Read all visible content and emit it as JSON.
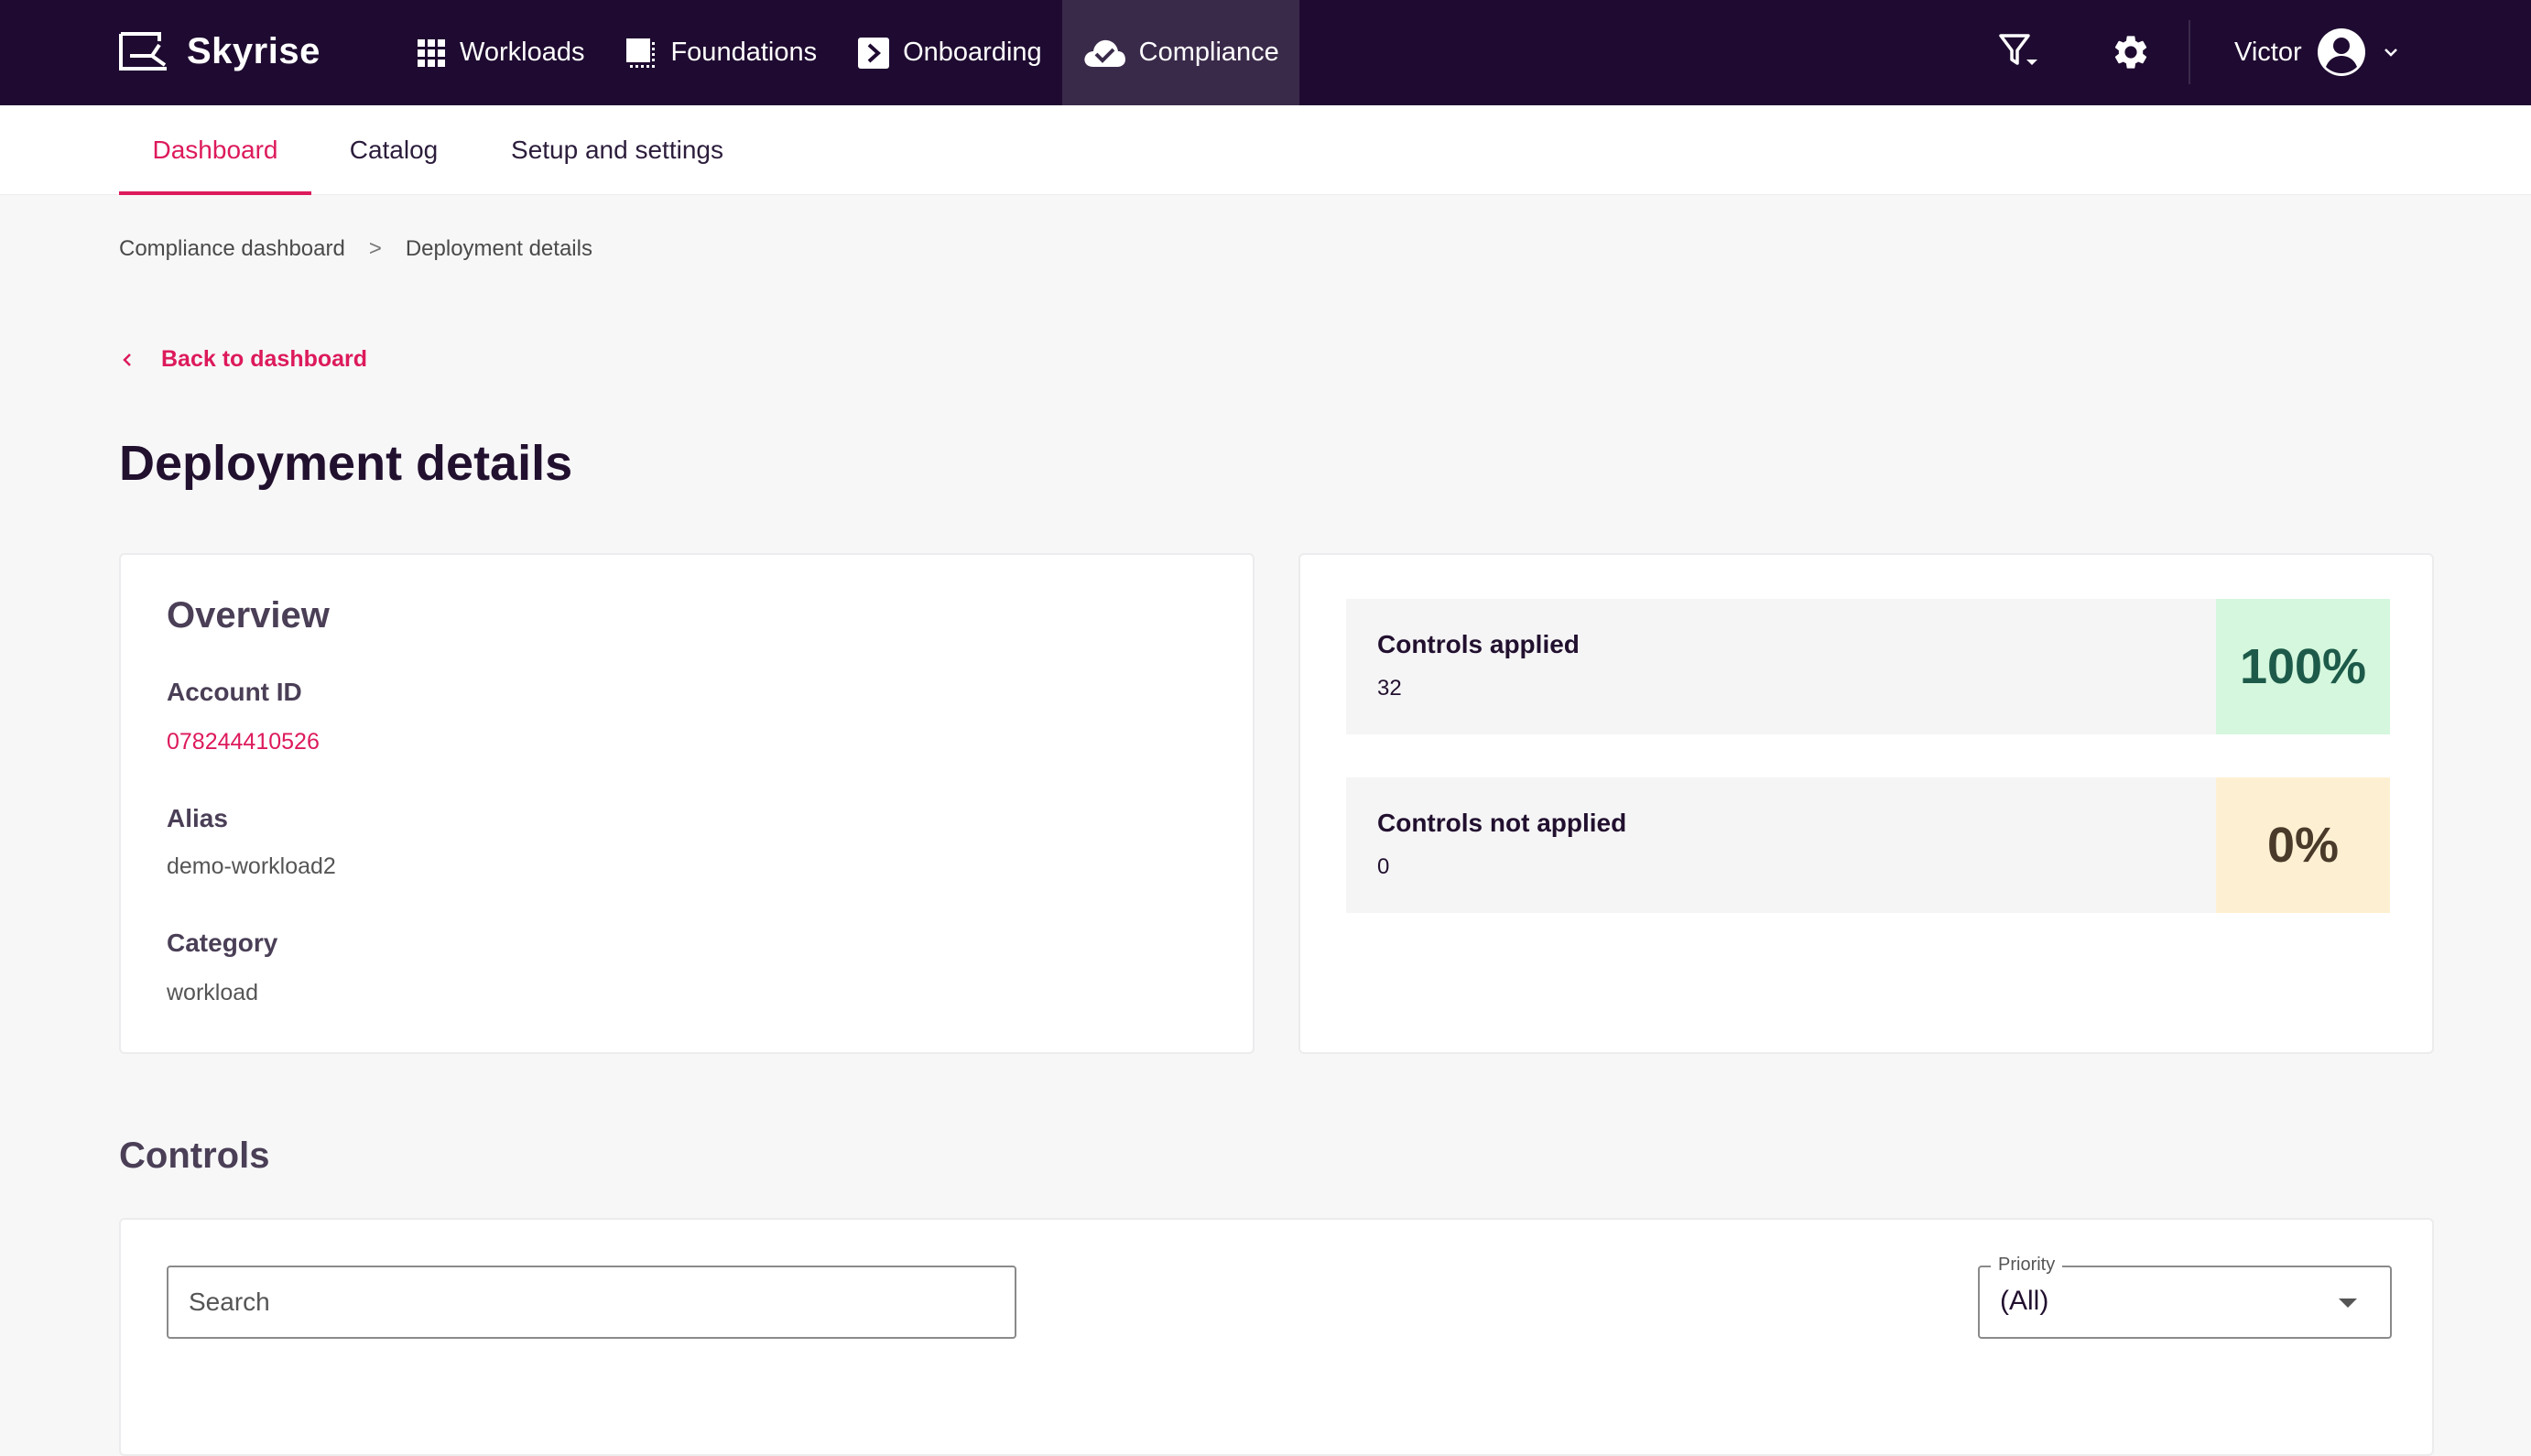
{
  "app": {
    "name": "Skyrise"
  },
  "nav": {
    "items": [
      {
        "label": "Workloads",
        "icon": "grid-icon"
      },
      {
        "label": "Foundations",
        "icon": "foundation-icon"
      },
      {
        "label": "Onboarding",
        "icon": "chevron-box-icon"
      },
      {
        "label": "Compliance",
        "icon": "cloud-check-icon",
        "active": true
      }
    ]
  },
  "user": {
    "name": "Victor"
  },
  "subnav": {
    "tabs": [
      {
        "label": "Dashboard",
        "active": true
      },
      {
        "label": "Catalog"
      },
      {
        "label": "Setup and settings"
      }
    ]
  },
  "breadcrumb": {
    "items": [
      "Compliance dashboard",
      "Deployment details"
    ],
    "separator": ">"
  },
  "back_link": "Back to dashboard",
  "page_title": "Deployment details",
  "overview": {
    "title": "Overview",
    "account_id_label": "Account ID",
    "account_id": "078244410526",
    "alias_label": "Alias",
    "alias": "demo-workload2",
    "category_label": "Category",
    "category": "workload"
  },
  "stats": {
    "applied": {
      "label": "Controls applied",
      "count": "32",
      "percent": "100%",
      "color": "#d4f7dd",
      "text_color": "#1d5a4a"
    },
    "not_applied": {
      "label": "Controls not applied",
      "count": "0",
      "percent": "0%",
      "color": "#fdf0d2",
      "text_color": "#4a3a2a"
    }
  },
  "controls": {
    "title": "Controls",
    "search_placeholder": "Search",
    "priority_label": "Priority",
    "priority_value": "(All)"
  },
  "colors": {
    "topbar": "#1f0b31",
    "accent": "#dd1a5b"
  }
}
